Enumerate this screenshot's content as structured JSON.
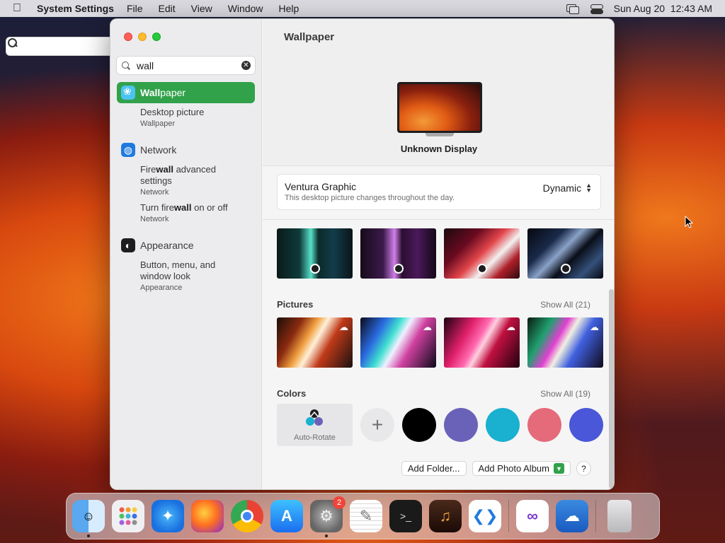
{
  "menubar": {
    "app_name": "System Settings",
    "menus": [
      "File",
      "Edit",
      "View",
      "Window",
      "Help"
    ],
    "clock": "Sun Aug 20  12:43 AM"
  },
  "sidebar": {
    "search_value": "wall",
    "selected": {
      "match": "Wall",
      "rest": "paper"
    },
    "results": [
      {
        "title": "Desktop picture",
        "subtitle": "Wallpaper"
      },
      {
        "category": "Network"
      },
      {
        "title_pre": "Fire",
        "title_match": "wall",
        "title_post": " advanced settings",
        "subtitle": "Network"
      },
      {
        "title_pre": "Turn fire",
        "title_match": "wall",
        "title_post": " on or off",
        "subtitle": "Network"
      },
      {
        "category": "Appearance"
      },
      {
        "title": "Button, menu, and window look",
        "subtitle": "Appearance"
      }
    ]
  },
  "main": {
    "title": "Wallpaper",
    "display_name": "Unknown Display",
    "current": {
      "name": "Ventura Graphic",
      "description": "This desktop picture changes throughout the day.",
      "mode": "Dynamic"
    },
    "sections": {
      "pictures": {
        "title": "Pictures",
        "show_all": "Show All (21)"
      },
      "colors": {
        "title": "Colors",
        "show_all": "Show All (19)",
        "auto_rotate": "Auto-Rotate"
      }
    },
    "buttons": {
      "add_folder": "Add Folder...",
      "add_album": "Add Photo Album",
      "help": "?"
    }
  },
  "colors": {
    "accent": "#31a14a",
    "swatches": [
      "#000000",
      "#6a62b8",
      "#1ab0d0",
      "#e56a7a",
      "#4a57d8"
    ]
  },
  "dock": {
    "apps": [
      "Finder",
      "Launchpad",
      "Safari",
      "Firefox",
      "Chrome",
      "App Store",
      "System Settings",
      "TextEdit",
      "Terminal",
      "GarageBand",
      "Visual Studio Code",
      "Visual Studio",
      "Weather",
      "Trash"
    ],
    "settings_badge": "2"
  }
}
